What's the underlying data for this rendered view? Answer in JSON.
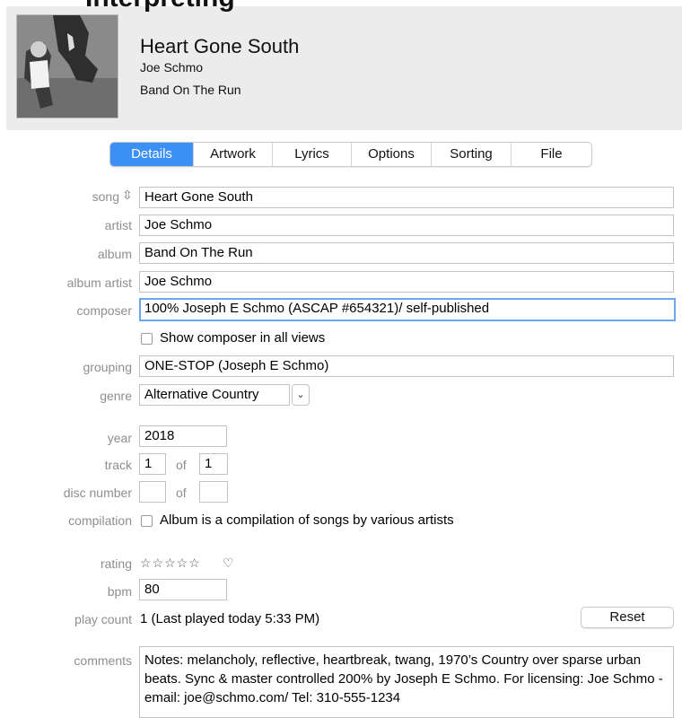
{
  "header": {
    "overlay_title": "Interpreting",
    "song_title": "Heart Gone South",
    "artist": "Joe Schmo",
    "album": "Band On The Run"
  },
  "tabs": [
    {
      "label": "Details",
      "active": true
    },
    {
      "label": "Artwork",
      "active": false
    },
    {
      "label": "Lyrics",
      "active": false
    },
    {
      "label": "Options",
      "active": false
    },
    {
      "label": "Sorting",
      "active": false
    },
    {
      "label": "File",
      "active": false
    }
  ],
  "labels": {
    "song": "song",
    "artist": "artist",
    "album": "album",
    "album_artist": "album artist",
    "composer": "composer",
    "grouping": "grouping",
    "genre": "genre",
    "year": "year",
    "track": "track",
    "disc_number": "disc number",
    "compilation": "compilation",
    "rating": "rating",
    "bpm": "bpm",
    "play_count": "play count",
    "comments": "comments",
    "of": "of"
  },
  "fields": {
    "song": "Heart Gone South",
    "artist": "Joe Schmo",
    "album": "Band On The Run",
    "album_artist": "Joe Schmo",
    "composer": "100% Joseph E Schmo (ASCAP #654321)/ self-published",
    "grouping": "ONE-STOP (Joseph E Schmo)",
    "genre": "Alternative Country",
    "year": "2018",
    "track": "1",
    "track_of": "1",
    "disc": "",
    "disc_of": "",
    "bpm": "80",
    "play_count": "1 (Last played today 5:33 PM)",
    "comments": "Notes: melancholy, reflective, heartbreak, twang, 1970’s Country over sparse urban beats. Sync & master controlled 200%  by Joseph E Schmo. For licensing: Joe Schmo - email: joe@schmo.com/ Tel: 310-555-1234"
  },
  "checkboxes": {
    "show_composer": {
      "label": "Show composer in all views",
      "checked": false
    },
    "compilation": {
      "label": "Album is a compilation of songs by various artists",
      "checked": false
    }
  },
  "rating": {
    "stars": 0,
    "max": 5,
    "star_glyphs": "☆☆☆☆☆",
    "heart_glyph": "♡"
  },
  "buttons": {
    "reset": "Reset"
  },
  "icons": {
    "sort": "⇳",
    "chevron": "⌄"
  },
  "colors": {
    "accent": "#3b8ff5",
    "label": "#8e8e8e",
    "header_bg": "#ececec",
    "focus": "#6aa7f0"
  }
}
